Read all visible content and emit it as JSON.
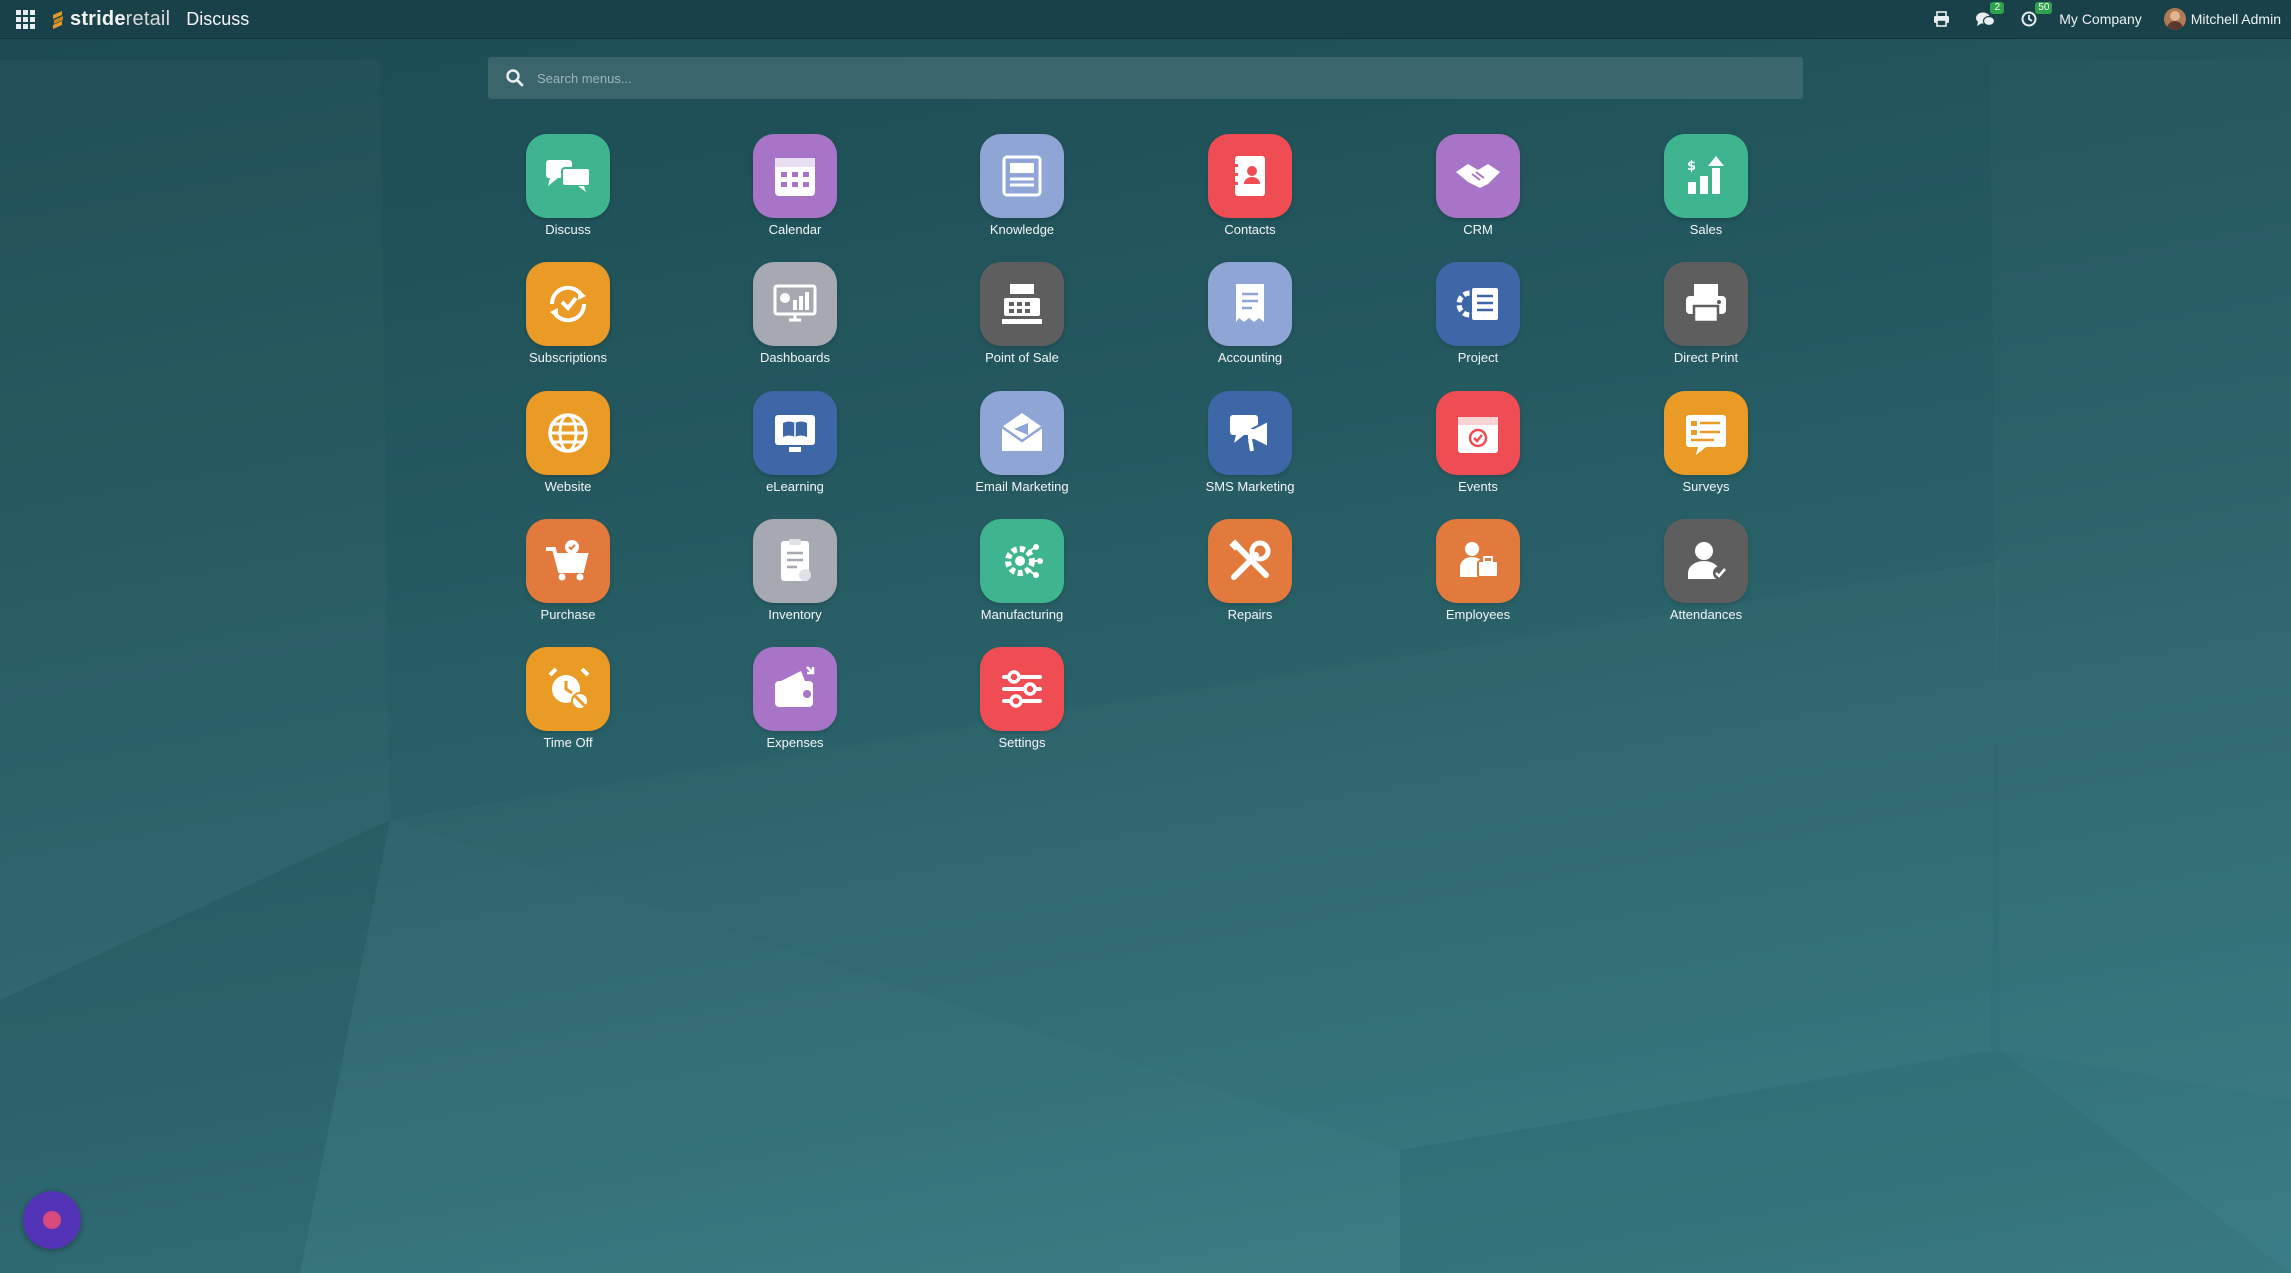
{
  "topbar": {
    "brand_bold": "stride",
    "brand_light": "retail",
    "app_title": "Discuss",
    "messages_count": "2",
    "activities_count": "50",
    "company": "My Company",
    "user": "Mitchell Admin"
  },
  "search": {
    "placeholder": "Search menus..."
  },
  "apps": [
    {
      "label": "Discuss",
      "color": "#3fb58f",
      "icon": "discuss-icon"
    },
    {
      "label": "Calendar",
      "color": "#a774c8",
      "icon": "calendar-icon"
    },
    {
      "label": "Knowledge",
      "color": "#8ea5d6",
      "icon": "knowledge-icon"
    },
    {
      "label": "Contacts",
      "color": "#ef4d53",
      "icon": "contacts-icon"
    },
    {
      "label": "CRM",
      "color": "#a774c8",
      "icon": "crm-icon"
    },
    {
      "label": "Sales",
      "color": "#3fb58f",
      "icon": "sales-icon"
    },
    {
      "label": "Subscriptions",
      "color": "#ea9b26",
      "icon": "subscriptions-icon"
    },
    {
      "label": "Dashboards",
      "color": "#a6a9b2",
      "icon": "dashboards-icon"
    },
    {
      "label": "Point of Sale",
      "color": "#5e5e5e",
      "icon": "point-of-sale-icon"
    },
    {
      "label": "Accounting",
      "color": "#8ea5d6",
      "icon": "accounting-icon"
    },
    {
      "label": "Project",
      "color": "#3e67a8",
      "icon": "project-icon"
    },
    {
      "label": "Direct Print",
      "color": "#5e5e5e",
      "icon": "direct-print-icon"
    },
    {
      "label": "Website",
      "color": "#ea9b26",
      "icon": "website-icon"
    },
    {
      "label": "eLearning",
      "color": "#3e67a8",
      "icon": "elearning-icon"
    },
    {
      "label": "Email Marketing",
      "color": "#8ea5d6",
      "icon": "email-marketing-icon"
    },
    {
      "label": "SMS Marketing",
      "color": "#3e67a8",
      "icon": "sms-marketing-icon"
    },
    {
      "label": "Events",
      "color": "#ef4d53",
      "icon": "events-icon"
    },
    {
      "label": "Surveys",
      "color": "#ea9b26",
      "icon": "surveys-icon"
    },
    {
      "label": "Purchase",
      "color": "#e37a3d",
      "icon": "purchase-icon"
    },
    {
      "label": "Inventory",
      "color": "#a6a9b2",
      "icon": "inventory-icon"
    },
    {
      "label": "Manufacturing",
      "color": "#3fb58f",
      "icon": "manufacturing-icon"
    },
    {
      "label": "Repairs",
      "color": "#e37a3d",
      "icon": "repairs-icon"
    },
    {
      "label": "Employees",
      "color": "#e37a3d",
      "icon": "employees-icon"
    },
    {
      "label": "Attendances",
      "color": "#5e5e5e",
      "icon": "attendances-icon"
    },
    {
      "label": "Time Off",
      "color": "#ea9b26",
      "icon": "time-off-icon"
    },
    {
      "label": "Expenses",
      "color": "#a774c8",
      "icon": "expenses-icon"
    },
    {
      "label": "Settings",
      "color": "#ef4d53",
      "icon": "settings-icon"
    }
  ]
}
